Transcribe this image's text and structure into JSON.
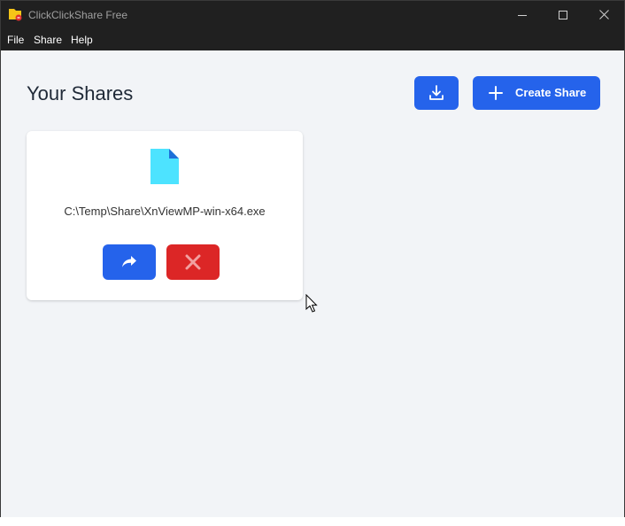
{
  "window": {
    "title": "ClickClickShare Free"
  },
  "menu": {
    "items": [
      "File",
      "Share",
      "Help"
    ]
  },
  "header": {
    "title": "Your Shares",
    "create_label": "Create Share",
    "download_icon": "download-icon",
    "plus_icon": "plus-icon"
  },
  "shares": [
    {
      "path": "C:\\Temp\\Share\\XnViewMP-win-x64.exe",
      "file_icon": "file-icon",
      "share_icon": "share-arrow-icon",
      "delete_icon": "close-icon"
    }
  ],
  "colors": {
    "primary": "#2563eb",
    "danger": "#dc2626",
    "file_icon": "#4de3ff",
    "background": "#f2f4f7",
    "titlebar": "#202020"
  }
}
